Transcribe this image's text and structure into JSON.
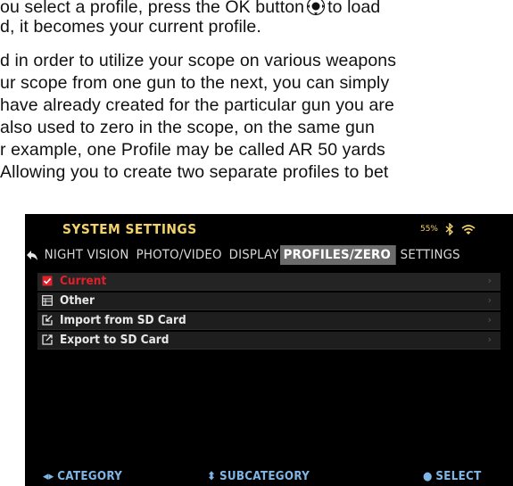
{
  "document": {
    "lines": [
      "ou select a profile, press the OK button",
      "to load",
      "d, it becomes your current profile.",
      "d in order to utilize your scope on various weapons",
      "ur scope from one gun to the next, you can simply",
      "have already created for the particular gun you are",
      " also used to zero in the scope, on the same gun",
      "r example, one Profile may be called AR 50 yards",
      " Allowing you to create two separate profiles to bet"
    ]
  },
  "screen": {
    "title": "SYSTEM SETTINGS",
    "status": {
      "battery": "55%",
      "icons": [
        "bluetooth-icon",
        "wifi-icon"
      ]
    },
    "tabs": [
      {
        "label": "NIGHT VISION"
      },
      {
        "label": "PHOTO/VIDEO"
      },
      {
        "label": "DISPLAY"
      },
      {
        "label": "PROFILES/ZERO",
        "active": true
      },
      {
        "label": "SETTINGS"
      }
    ],
    "menu": [
      {
        "label": "Current",
        "icon": "checked-box-icon",
        "selected": true
      },
      {
        "label": "Other",
        "icon": "list-icon"
      },
      {
        "label": "Import from SD Card",
        "icon": "import-icon"
      },
      {
        "label": "Export to SD Card",
        "icon": "export-icon"
      }
    ],
    "footer": {
      "category": "CATEGORY",
      "subcategory": "SUBCATEGORY",
      "select": "SELECT"
    },
    "colors": {
      "title": "#f2d26b",
      "selected": "#e0202a",
      "footer": "#7fb6e6",
      "active_tab": "#6b6b6b"
    }
  }
}
